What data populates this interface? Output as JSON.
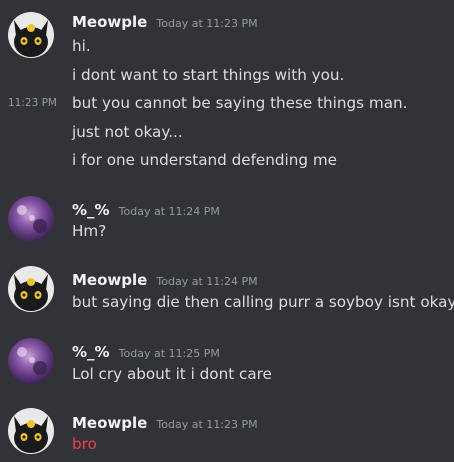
{
  "messages": [
    {
      "author": "Meowple",
      "timestamp": "Today at 11:23 PM",
      "avatar": "black-cat-avatar",
      "lines": [
        "hi.",
        "i dont want to start things with you.",
        "but you cannot be saying these things man.",
        "just not okay...",
        "i for one understand defending me"
      ],
      "hover_time": "11:23 PM"
    },
    {
      "author": "%_%",
      "timestamp": "Today at 11:24 PM",
      "avatar": "purple-galaxy-avatar",
      "lines": [
        "Hm?"
      ]
    },
    {
      "author": "Meowple",
      "timestamp": "Today at 11:24 PM",
      "avatar": "black-cat-avatar",
      "lines": [
        "but saying die then calling purr a soyboy isnt okay..."
      ]
    },
    {
      "author": "%_%",
      "timestamp": "Today at 11:25 PM",
      "avatar": "purple-galaxy-avatar",
      "lines": [
        "Lol cry about it i dont care"
      ]
    },
    {
      "author": "Meowple",
      "timestamp": "Today at 11:23 PM",
      "avatar": "black-cat-avatar",
      "lines": [
        "bro"
      ],
      "line_color": "#f23f43"
    }
  ],
  "colors": {
    "background": "#313338",
    "username": "#f2f3f5",
    "timestamp": "#949ba4",
    "text": "#dbdee1",
    "red_text": "#f23f43"
  }
}
